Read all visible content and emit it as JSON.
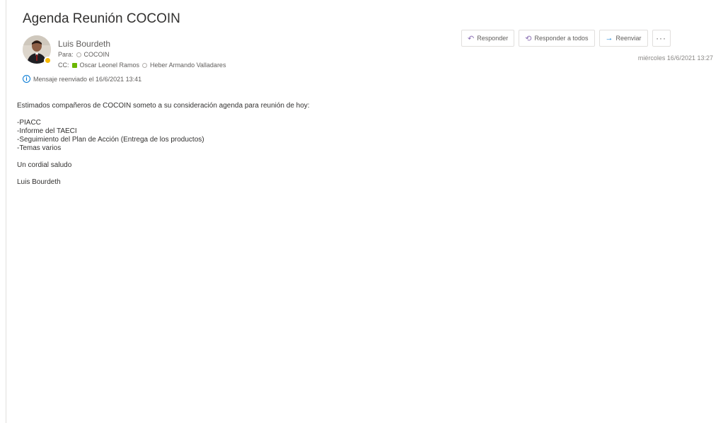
{
  "email": {
    "subject": "Agenda Reunión COCOIN",
    "sender": "Luis Bourdeth",
    "to_label": "Para:",
    "to": "COCOIN",
    "cc_label": "CC:",
    "cc": [
      "Oscar Leonel Ramos",
      "Heber Armando Valladares"
    ],
    "info": "Mensaje reenviado el 16/6/2021 13:41",
    "date": "miércoles 16/6/2021 13:27"
  },
  "actions": {
    "reply": "Responder",
    "reply_all": "Responder a todos",
    "forward": "Reenviar",
    "more": "···"
  },
  "body": {
    "intro": "Estimados compañeros de COCOIN someto a su consideración agenda para reunión de hoy:",
    "items": [
      "-PIACC",
      "-Informe del TAECI",
      "-Seguimiento del Plan de Acción (Entrega de los productos)",
      "-Temas varios"
    ],
    "closing": "Un cordial saludo",
    "signature": "Luis Bourdeth"
  },
  "colors": {
    "accent": "#0078d4",
    "presence": "#f8b900",
    "status_green": "#6bb700"
  }
}
